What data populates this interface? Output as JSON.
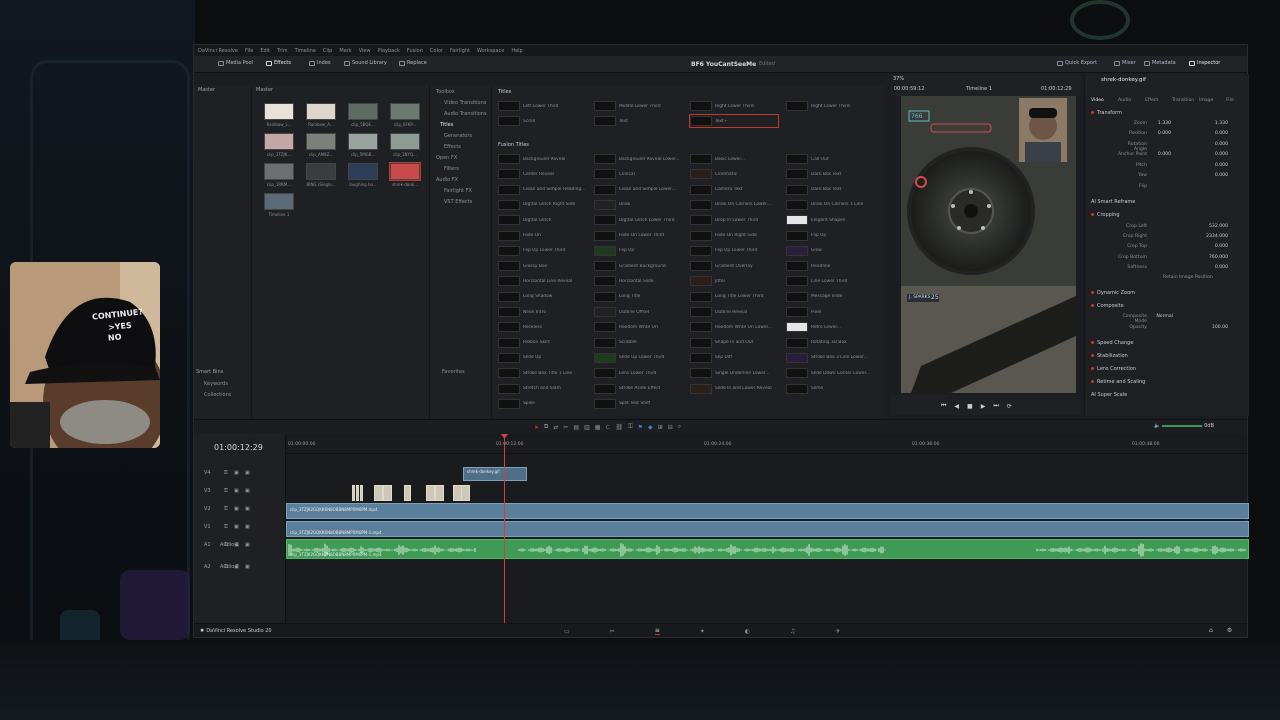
{
  "app": {
    "menu": [
      "DaVinci Resolve",
      "File",
      "Edit",
      "Trim",
      "Timeline",
      "Clip",
      "Mark",
      "View",
      "Playback",
      "Fusion",
      "Color",
      "Fairlight",
      "Workspace",
      "Help"
    ],
    "project_title": "BF6 YouCantSeeMe",
    "project_status": "Edited",
    "status_bar_label": "DaVinci Resolve Studio 20"
  },
  "toolbar": {
    "media_pool": "Media Pool",
    "effects": "Effects",
    "index": "Index",
    "sound_library": "Sound Library",
    "replace": "Replace",
    "quick_export": "Quick Export",
    "mixer": "Mixer",
    "metadata": "Metadata",
    "inspector": "Inspector"
  },
  "media_pool": {
    "root": "Master",
    "crumb": "Master",
    "smart_bins": "Smart Bins",
    "smart_items": [
      "Keywords",
      "Collections"
    ],
    "clips": [
      "Rainbow_L...",
      "Rainbow_A...",
      "clip_5BQE...",
      "clip_0FKP...",
      "clip_3TZJK...",
      "clip_AM8Z...",
      "clip_5MGB...",
      "clip_1NYQ...",
      "clip_1RKM...",
      "BING (Single...",
      "laughing ho...",
      "shrek-donk...",
      "Timeline 1"
    ]
  },
  "effects": {
    "tree": [
      "Toolbox",
      "Video Transitions",
      "Audio Transitions",
      "Titles",
      "Generators",
      "Effects",
      "Open FX",
      "Filters",
      "Audio FX",
      "Fairlight FX",
      "VST Effects"
    ],
    "favorites": "Favorites",
    "titles_header": "Titles",
    "titles": [
      "Left Lower Third",
      "Middle Lower Third",
      "Right Lower Third",
      "Scroll",
      "Text",
      "Text+"
    ],
    "fusion_header": "Fusion Titles",
    "fusion_titles": [
      "Background Reveal",
      "Background Reveal Lower...",
      "Basic Lower...",
      "Call Out",
      "Center Reveal",
      "Clinical",
      "Cinematic",
      "Dark Box Text",
      "Clean and Simple Heading...",
      "Clean and Simple Lower...",
      "Camera Text",
      "Dark Box Text",
      "Digital Glitch Right Side",
      "Draw",
      "Draw On Corners Lower...",
      "Draw On Corners 1 Line",
      "Digital Glitch",
      "Digital Glitch Lower Third",
      "Drop In Lower Third",
      "Elegant Shapes",
      "Fade On",
      "Fade On Lower Third",
      "Fade On Right Side",
      "Flip Up",
      "Flip Up Lower Third",
      "Flip Up",
      "Flip Up Lower Third",
      "Glow",
      "Glossy Box",
      "Gradient Background",
      "Gradient Overlay",
      "Headline",
      "Horizontal Line Reveal",
      "Horizontal Slide",
      "Jitter",
      "Line Lower Third",
      "Long Shadow",
      "Long Title",
      "Long Title Lower Third",
      "Message Slide",
      "Neon Intro",
      "Outline Offset",
      "Outline Reveal",
      "Pixel",
      "Reckless",
      "Random Write On",
      "Random Write On Lower...",
      "Retro Lower...",
      "Ribbon Skirt",
      "Scribble",
      "Shape In and Out",
      "Rotating 3D Box",
      "Slide Up",
      "Slide Up Lower Third",
      "Slip Diff",
      "Stroke Box 3 Line Lower...",
      "Stroke Box Title 1 Line",
      "Lens Lower Third",
      "Single Underline Lower...",
      "Slide Down Corner Lower...",
      "Stretch and Slam",
      "Stroke Aside Effect",
      "Slide In and Lower Reveal",
      "Slime",
      "Spike",
      "Split Text Shift"
    ]
  },
  "viewer": {
    "timecode_left": "00:00:59:12",
    "zoom": "37%",
    "timeline_name": "Timeline 1",
    "timecode_right": "01:00:12:29",
    "hud_ammo": "766",
    "hud_ammo2": "25",
    "hud_squad": "J. SPARKS"
  },
  "inspector": {
    "clip_name": "shrek-donkey.gif",
    "tabs": [
      "Video",
      "Audio",
      "Effect",
      "Transition",
      "Image",
      "File"
    ],
    "transform": "Transform",
    "zoom_label": "Zoom",
    "zoom_x": "1.330",
    "zoom_y": "1.330",
    "position_label": "Position",
    "position_x": "0.000",
    "position_y": "0.000",
    "rotation_label": "Rotation Angle",
    "anchor_label": "Anchor Point",
    "anchor_x": "0.000",
    "anchor_y": "0.000",
    "pitch_label": "Pitch",
    "yaw_label": "Yaw",
    "flip_label": "Flip",
    "rot_val": "0.000",
    "pitch_val": "0.000",
    "yaw_val": "0.000",
    "smart_reframe": "AI Smart Reframe",
    "cropping": "Cropping",
    "crop_left": "Crop Left",
    "crop_left_val": "532.000",
    "crop_right": "Crop Right",
    "crop_right_val": "2334.000",
    "crop_top": "Crop Top",
    "crop_top_val": "0.000",
    "crop_bottom": "Crop Bottom",
    "crop_bottom_val": "760.000",
    "softness": "Softness",
    "softness_val": "0.000",
    "retain": "Retain Image Position",
    "dynamic_zoom": "Dynamic Zoom",
    "composite": "Composite",
    "composite_mode": "Composite Mode",
    "composite_mode_val": "Normal",
    "opacity": "Opacity",
    "opacity_val": "100.00",
    "speed_change": "Speed Change",
    "stabilization": "Stabilization",
    "lens_correction": "Lens Correction",
    "retime": "Retime and Scaling",
    "super_scale": "AI Super Scale"
  },
  "timeline": {
    "timecode": "01:00:12:29",
    "ruler": [
      "01:00:00:00",
      "01:00:12:00",
      "01:00:24:00",
      "01:00:36:00",
      "01:00:48:00"
    ],
    "tracks": [
      "V4",
      "V3",
      "V2",
      "V1",
      "A1",
      "A2"
    ],
    "audio1_name": "Audio 1",
    "audio2_name": "Audio 2",
    "volume": "0dB",
    "clip_v4": "shrek-donkey.gif",
    "clip_v2": "clip_3TZJK2GQKK6N8OBBN8MPXM0PM.mp4",
    "clip_v1": "clip_3TZJK2GQKK6N8OBBN8MPXM0PM-1.mp4",
    "clip_a1": "clip_3TZJK2GQKK6N8OBBN8MPXM0PM-1.mp4"
  },
  "webcam": {
    "cap_text_1": "CONTINUE?",
    "cap_text_2": ">YES",
    "cap_text_3": "NO"
  },
  "colors": {
    "accent": "#c0392b",
    "video_clip": "#5b7e9a",
    "audio_clip": "#3f9a55"
  }
}
